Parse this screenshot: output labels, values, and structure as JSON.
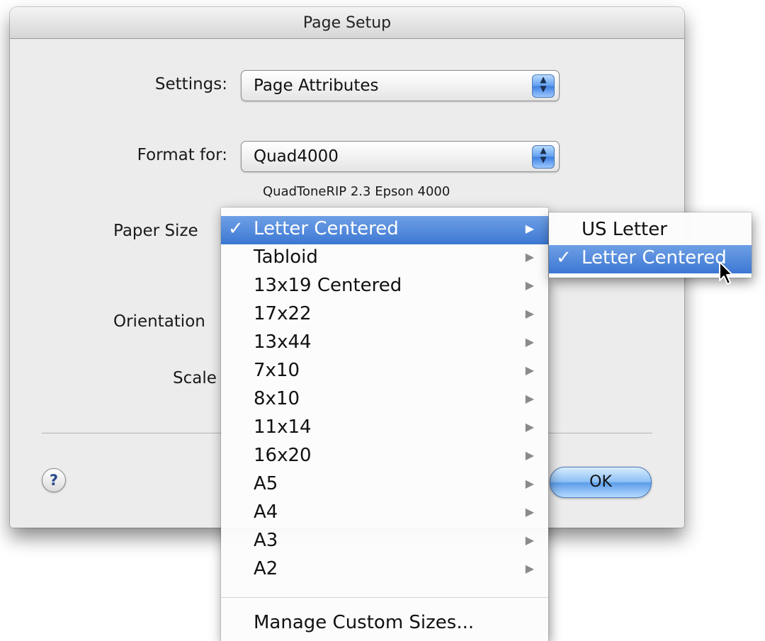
{
  "dialog": {
    "title": "Page Setup",
    "settings_label": "Settings:",
    "settings_value": "Page Attributes",
    "format_label": "Format for:",
    "format_value": "Quad4000",
    "printer_description": "QuadToneRIP 2.3 Epson 4000",
    "paper_size_label": "Paper Size",
    "orientation_label": "Orientation",
    "scale_label": "Scale",
    "help_label": "?",
    "ok_label": "OK"
  },
  "paper_menu": {
    "check_glyph": "✓",
    "items": [
      {
        "label": "Letter Centered",
        "checked": true
      },
      {
        "label": "Tabloid"
      },
      {
        "label": "13x19 Centered"
      },
      {
        "label": "17x22"
      },
      {
        "label": "13x44"
      },
      {
        "label": "7x10"
      },
      {
        "label": "8x10"
      },
      {
        "label": "11x14"
      },
      {
        "label": "16x20"
      },
      {
        "label": "A5"
      },
      {
        "label": "A4"
      },
      {
        "label": "A3"
      },
      {
        "label": "A2"
      }
    ],
    "manage_label": "Manage Custom Sizes..."
  },
  "submenu": {
    "items": [
      {
        "label": "US Letter"
      },
      {
        "label": "Letter Centered",
        "checked": true
      }
    ]
  },
  "colors": {
    "menu_highlight": "#3c77d3",
    "window_background": "#ececec",
    "default_button": "#5b9de9"
  },
  "icons": {
    "stepper": "up-down-arrows-icon",
    "submenu": "triangle-right-icon",
    "checkmark": "checkmark-icon",
    "pointer": "mouse-pointer-icon"
  }
}
